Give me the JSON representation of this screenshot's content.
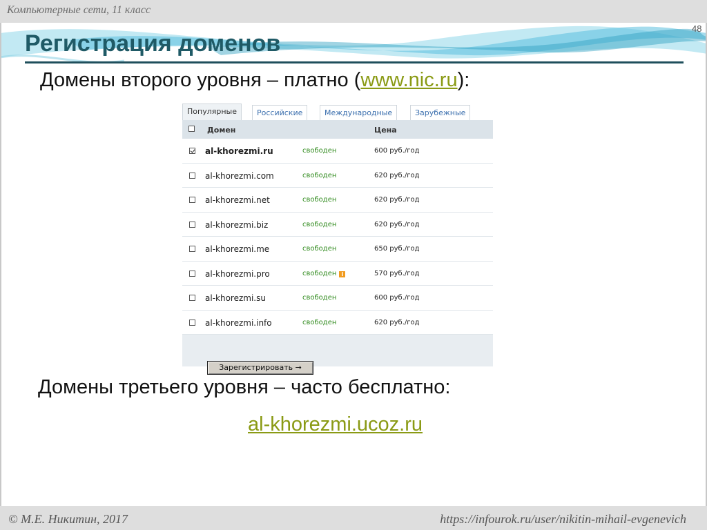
{
  "header": {
    "course": "Компьютерные сети, 11 класс",
    "slide_number": "48"
  },
  "title": "Регистрация доменов",
  "line1": {
    "before": "Домены второго уровня – платно (",
    "link": "www.nic.ru",
    "after": "):"
  },
  "widget": {
    "tabs": [
      "Популярные",
      "Российские",
      "Международные",
      "Зарубежные"
    ],
    "active_tab": 0,
    "columns": {
      "domain": "Домен",
      "price": "Цена"
    },
    "rows": [
      {
        "domain": "al-khorezmi.ru",
        "status": "свободен",
        "price": "600 руб./год",
        "checked": true,
        "bold": true,
        "info": false
      },
      {
        "domain": "al-khorezmi.com",
        "status": "свободен",
        "price": "620 руб./год",
        "checked": false,
        "bold": false,
        "info": false
      },
      {
        "domain": "al-khorezmi.net",
        "status": "свободен",
        "price": "620 руб./год",
        "checked": false,
        "bold": false,
        "info": false
      },
      {
        "domain": "al-khorezmi.biz",
        "status": "свободен",
        "price": "620 руб./год",
        "checked": false,
        "bold": false,
        "info": false
      },
      {
        "domain": "al-khorezmi.me",
        "status": "свободен",
        "price": "650 руб./год",
        "checked": false,
        "bold": false,
        "info": false
      },
      {
        "domain": "al-khorezmi.pro",
        "status": "свободен",
        "price": "570 руб./год",
        "checked": false,
        "bold": false,
        "info": true
      },
      {
        "domain": "al-khorezmi.su",
        "status": "свободен",
        "price": "600 руб./год",
        "checked": false,
        "bold": false,
        "info": false
      },
      {
        "domain": "al-khorezmi.info",
        "status": "свободен",
        "price": "620 руб./год",
        "checked": false,
        "bold": false,
        "info": false
      }
    ],
    "register_button": "Зарегистрировать →"
  },
  "line2": "Домены третьего уровня – часто бесплатно:",
  "line3_link": "al-khorezmi.ucoz.ru",
  "footer": {
    "left": "© М.Е. Никитин, 2017",
    "right": "https://infourok.ru/user/nikitin-mihail-evgenevich"
  },
  "colors": {
    "title": "#1f5a66",
    "link": "#8a9a14",
    "status_free": "#2f8a1c",
    "wave": "#5bc0de"
  }
}
